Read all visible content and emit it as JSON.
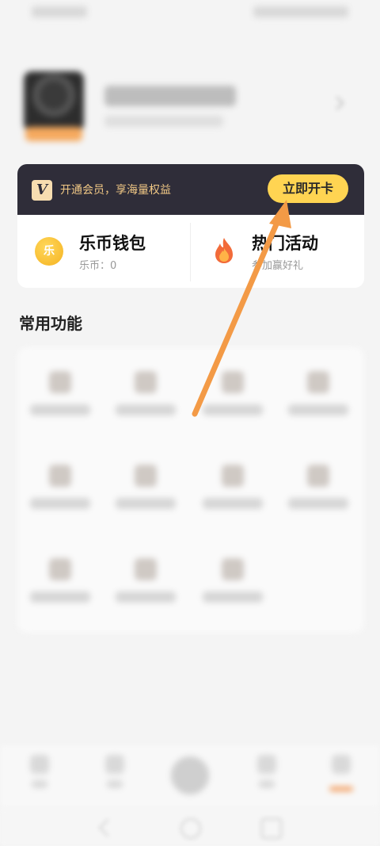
{
  "vip": {
    "logo": "V",
    "text": "开通会员，享海量权益",
    "button": "立即开卡"
  },
  "wallet": {
    "icon_glyph": "乐",
    "title": "乐币钱包",
    "subtitle": "乐币：0"
  },
  "events": {
    "title": "热门活动",
    "subtitle": "参加赢好礼"
  },
  "section": {
    "title": "常用功能"
  },
  "icons": {
    "wallet": "coin-icon",
    "events": "fire-icon",
    "arrow": "guide-arrow"
  },
  "colors": {
    "vip_bg": "#2f2d39",
    "vip_text": "#f1c885",
    "vip_button": "#ffd452",
    "accent": "#f39a46"
  }
}
